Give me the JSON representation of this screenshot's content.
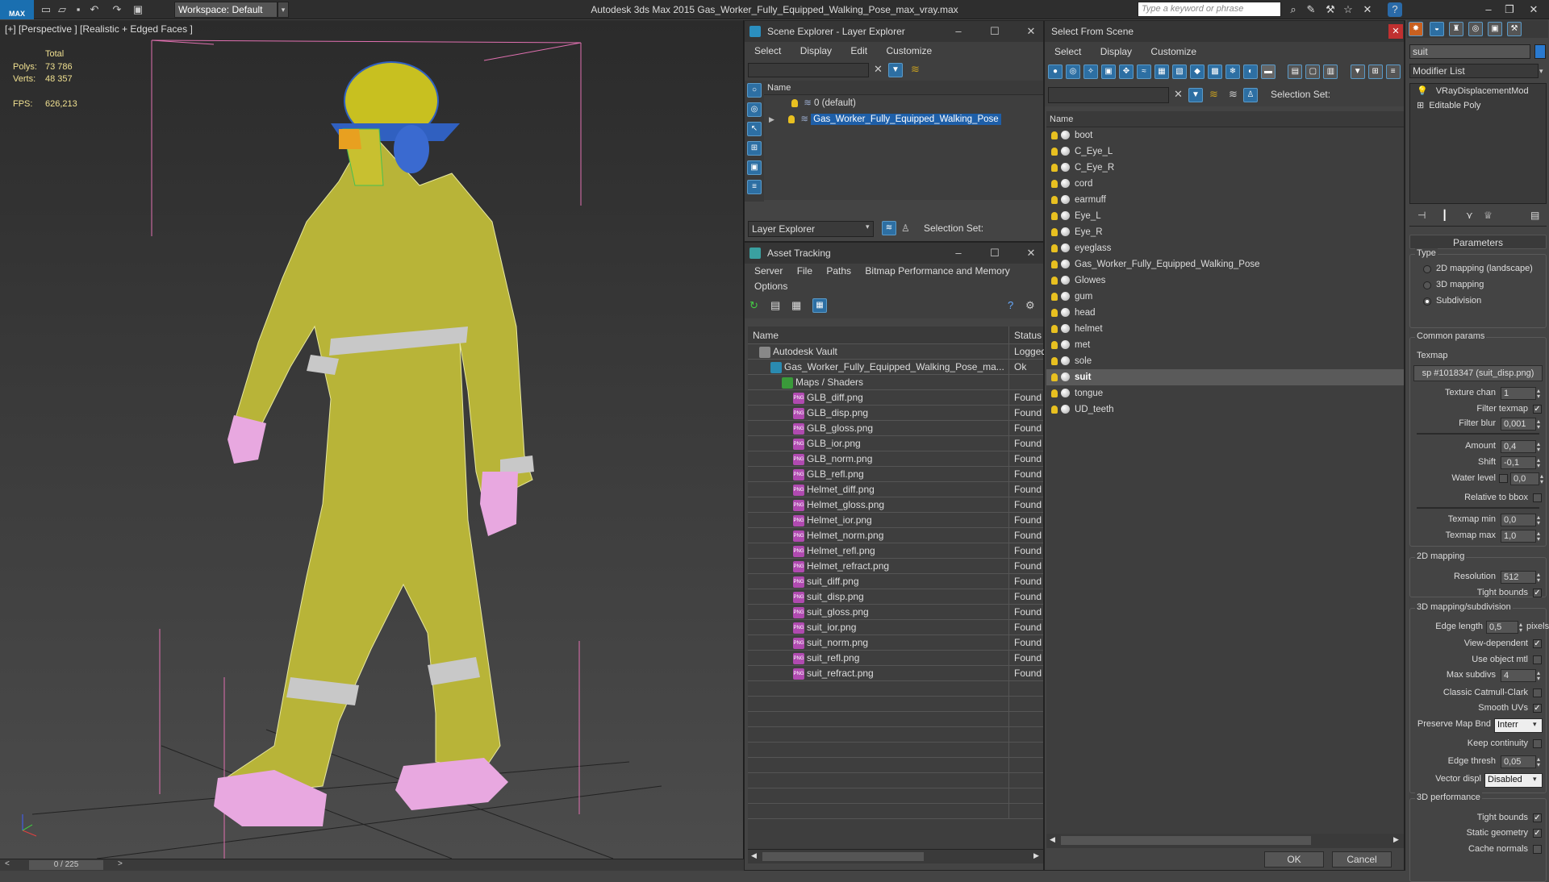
{
  "titlebar": {
    "logo": "MAX",
    "workspace": "Workspace: Default",
    "title": "Autodesk 3ds Max  2015     Gas_Worker_Fully_Equipped_Walking_Pose_max_vray.max",
    "search_placeholder": "Type a keyword or phrase",
    "help": "?"
  },
  "viewport": {
    "label": "[+] [Perspective ] [Realistic + Edged Faces ]",
    "stats": {
      "total_label": "Total",
      "polys_label": "Polys:",
      "polys": "73 786",
      "verts_label": "Verts:",
      "verts": "48 357",
      "fps_label": "FPS:",
      "fps": "626,213"
    },
    "timeline": {
      "frame": "0 / 225",
      "prev": "<",
      "next": ">"
    }
  },
  "scene_explorer": {
    "title": "Scene Explorer - Layer Explorer",
    "menu": [
      "Select",
      "Display",
      "Edit",
      "Customize"
    ],
    "column": "Name",
    "layers": [
      {
        "name": "0 (default)",
        "selected": false
      },
      {
        "name": "Gas_Worker_Fully_Equipped_Walking_Pose",
        "selected": true
      }
    ],
    "footer_dropdown": "Layer Explorer",
    "selection_set": "Selection Set:"
  },
  "asset_tracking": {
    "title": "Asset Tracking",
    "menu": [
      "Server",
      "File",
      "Paths",
      "Bitmap Performance and Memory"
    ],
    "menu2": "Options",
    "columns": {
      "name": "Name",
      "status": "Status"
    },
    "rows": [
      {
        "name": "Autodesk Vault",
        "status": "Logged",
        "indent": 0,
        "kind": "vault"
      },
      {
        "name": "Gas_Worker_Fully_Equipped_Walking_Pose_ma...",
        "status": "Ok",
        "indent": 1,
        "kind": "max"
      },
      {
        "name": "Maps / Shaders",
        "status": "",
        "indent": 2,
        "kind": "folder"
      },
      {
        "name": "GLB_diff.png",
        "status": "Found",
        "indent": 3,
        "kind": "png"
      },
      {
        "name": "GLB_disp.png",
        "status": "Found",
        "indent": 3,
        "kind": "png"
      },
      {
        "name": "GLB_gloss.png",
        "status": "Found",
        "indent": 3,
        "kind": "png"
      },
      {
        "name": "GLB_ior.png",
        "status": "Found",
        "indent": 3,
        "kind": "png"
      },
      {
        "name": "GLB_norm.png",
        "status": "Found",
        "indent": 3,
        "kind": "png"
      },
      {
        "name": "GLB_refl.png",
        "status": "Found",
        "indent": 3,
        "kind": "png"
      },
      {
        "name": "Helmet_diff.png",
        "status": "Found",
        "indent": 3,
        "kind": "png"
      },
      {
        "name": "Helmet_gloss.png",
        "status": "Found",
        "indent": 3,
        "kind": "png"
      },
      {
        "name": "Helmet_ior.png",
        "status": "Found",
        "indent": 3,
        "kind": "png"
      },
      {
        "name": "Helmet_norm.png",
        "status": "Found",
        "indent": 3,
        "kind": "png"
      },
      {
        "name": "Helmet_refl.png",
        "status": "Found",
        "indent": 3,
        "kind": "png"
      },
      {
        "name": "Helmet_refract.png",
        "status": "Found",
        "indent": 3,
        "kind": "png"
      },
      {
        "name": "suit_diff.png",
        "status": "Found",
        "indent": 3,
        "kind": "png"
      },
      {
        "name": "suit_disp.png",
        "status": "Found",
        "indent": 3,
        "kind": "png"
      },
      {
        "name": "suit_gloss.png",
        "status": "Found",
        "indent": 3,
        "kind": "png"
      },
      {
        "name": "suit_ior.png",
        "status": "Found",
        "indent": 3,
        "kind": "png"
      },
      {
        "name": "suit_norm.png",
        "status": "Found",
        "indent": 3,
        "kind": "png"
      },
      {
        "name": "suit_refl.png",
        "status": "Found",
        "indent": 3,
        "kind": "png"
      },
      {
        "name": "suit_refract.png",
        "status": "Found",
        "indent": 3,
        "kind": "png"
      }
    ]
  },
  "select_from_scene": {
    "title": "Select From Scene",
    "menu": [
      "Select",
      "Display",
      "Customize"
    ],
    "selection_set": "Selection Set:",
    "column": "Name",
    "objects": [
      {
        "name": "boot",
        "selected": false
      },
      {
        "name": "C_Eye_L",
        "selected": false
      },
      {
        "name": "C_Eye_R",
        "selected": false
      },
      {
        "name": "cord",
        "selected": false
      },
      {
        "name": "earmuff",
        "selected": false
      },
      {
        "name": "Eye_L",
        "selected": false
      },
      {
        "name": "Eye_R",
        "selected": false
      },
      {
        "name": "eyeglass",
        "selected": false
      },
      {
        "name": "Gas_Worker_Fully_Equipped_Walking_Pose",
        "selected": false
      },
      {
        "name": "Glowes",
        "selected": false
      },
      {
        "name": "gum",
        "selected": false
      },
      {
        "name": "head",
        "selected": false
      },
      {
        "name": "helmet",
        "selected": false
      },
      {
        "name": "met",
        "selected": false
      },
      {
        "name": "sole",
        "selected": false
      },
      {
        "name": "suit",
        "selected": true
      },
      {
        "name": "tongue",
        "selected": false
      },
      {
        "name": "UD_teeth",
        "selected": false
      }
    ],
    "ok": "OK",
    "cancel": "Cancel"
  },
  "command_panel": {
    "object_name": "suit",
    "modifier_list": "Modifier List",
    "stack": [
      "VRayDisplacementMod",
      "Editable Poly"
    ],
    "parameters": "Parameters",
    "type_label": "Type",
    "types": [
      {
        "label": "2D mapping (landscape)",
        "on": false
      },
      {
        "label": "3D mapping",
        "on": false
      },
      {
        "label": "Subdivision",
        "on": true
      }
    ],
    "common": "Common params",
    "texmap_label": "Texmap",
    "texmap": "sp #1018347 (suit_disp.png)",
    "texture_chan_label": "Texture chan",
    "texture_chan": "1",
    "filter_texmap_label": "Filter texmap",
    "filter_blur_label": "Filter blur",
    "filter_blur": "0,001",
    "amount_label": "Amount",
    "amount": "0,4",
    "shift_label": "Shift",
    "shift": "-0,1",
    "water_label": "Water level",
    "water": "0,0",
    "relative_label": "Relative to bbox",
    "texmap_min_label": "Texmap min",
    "texmap_min": "0,0",
    "texmap_max_label": "Texmap max",
    "texmap_max": "1,0",
    "map2d": "2D mapping",
    "resolution_label": "Resolution",
    "resolution": "512",
    "tight_bounds_label": "Tight bounds",
    "map3d": "3D mapping/subdivision",
    "edge_length_label": "Edge length",
    "edge_length": "0,5",
    "pixels": "pixels",
    "view_dependent_label": "View-dependent",
    "use_object_mtl_label": "Use object mtl",
    "max_subdivs_label": "Max subdivs",
    "max_subdivs": "4",
    "catmull_label": "Classic Catmull-Clark",
    "smooth_uvs_label": "Smooth UVs",
    "preserve_label": "Preserve Map Bnd",
    "preserve": "Interr",
    "keep_label": "Keep continuity",
    "edge_thresh_label": "Edge thresh",
    "edge_thresh": "0,05",
    "vector_label": "Vector displ",
    "vector": "Disabled",
    "perf": "3D performance",
    "perf_tight_label": "Tight bounds",
    "static_label": "Static geometry",
    "cache_label": "Cache normals"
  }
}
